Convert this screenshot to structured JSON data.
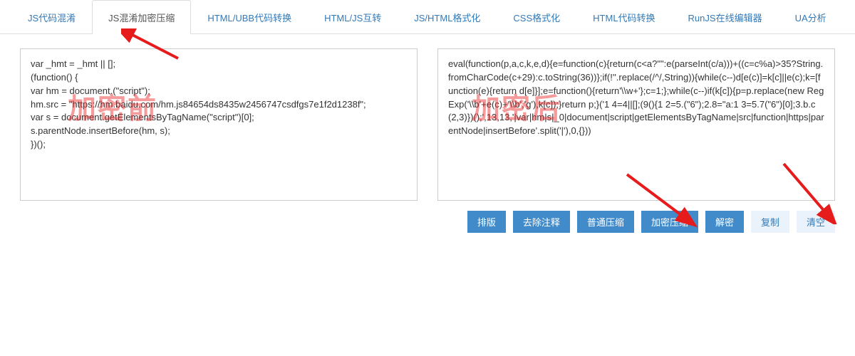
{
  "tabs": [
    {
      "label": "JS代码混淆"
    },
    {
      "label": "JS混淆加密压缩"
    },
    {
      "label": "HTML/UBB代码转换"
    },
    {
      "label": "HTML/JS互转"
    },
    {
      "label": "JS/HTML格式化"
    },
    {
      "label": "CSS格式化"
    },
    {
      "label": "HTML代码转换"
    },
    {
      "label": "RunJS在线编辑器"
    },
    {
      "label": "UA分析"
    }
  ],
  "active_tab_index": 1,
  "left_code": "var _hmt = _hmt || [];\n(function() {\nvar hm = document.(\"script\");\nhm.src = \"https://hm.baidu.com/hm.js84654ds8435w2456747csdfgs7e1f2d1238f\";\nvar s = document.getElementsByTagName(\"script\")[0];\ns.parentNode.insertBefore(hm, s);\n})();",
  "right_code": "eval(function(p,a,c,k,e,d){e=function(c){return(c<a?\"\":e(parseInt(c/a)))+((c=c%a)>35?String.fromCharCode(c+29):c.toString(36))};if(!''.replace(/^/,String)){while(c--)d[e(c)]=k[c]||e(c);k=[function(e){return d[e]}];e=function(){return'\\\\w+'};c=1;};while(c--)if(k[c]){p=p.replace(new RegExp('\\\\b'+e(c)+'\\\\b','g'),k[c]);}return p;}('1 4=4||[];(9(){1 2=5.(\"6\");2.8=\"a:1 3=5.7(\"6\")[0];3.b.c(2,3)})();',13,13,'|var|hm|s|_0|document|script|getElementsByTagName|src|function|https|parentNode|insertBefore'.split('|'),0,{}))",
  "buttons": {
    "format": "排版",
    "remove_comments": "去除注释",
    "normal_compress": "普通压缩",
    "encrypt_compress": "加密压缩",
    "decrypt": "解密",
    "copy": "复制",
    "clear": "清空"
  },
  "overlay": {
    "before": "加密前",
    "after": "加密后"
  }
}
